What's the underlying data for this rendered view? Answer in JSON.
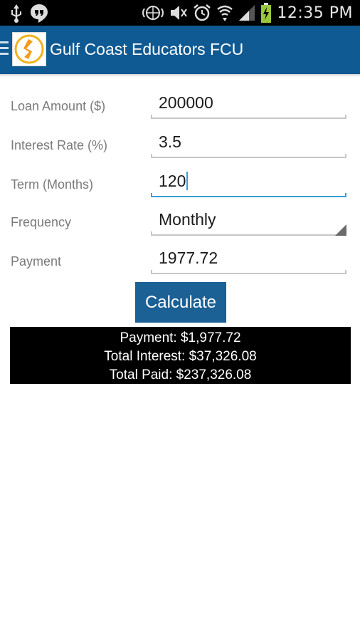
{
  "status_bar": {
    "time": "12:35 PM",
    "icons": [
      "usb-icon",
      "hangouts-icon",
      "nfc-icon",
      "mute-icon",
      "alarm-icon",
      "wifi-icon",
      "signal-icon",
      "battery-charging-icon"
    ]
  },
  "app_bar": {
    "title": "Gulf Coast Educators FCU",
    "color": "#0f5a93"
  },
  "form": {
    "loan_amount": {
      "label": "Loan Amount ($)",
      "value": "200000"
    },
    "interest_rate": {
      "label": "Interest Rate (%)",
      "value": "3.5"
    },
    "term": {
      "label": "Term (Months)",
      "value": "120"
    },
    "frequency": {
      "label": "Frequency",
      "value": "Monthly"
    },
    "payment": {
      "label": "Payment",
      "value": "1977.72"
    }
  },
  "calculate_button": {
    "label": "Calculate",
    "color": "#1b6196"
  },
  "results": {
    "payment": "Payment: $1,977.72",
    "total_interest": "Total Interest: $37,326.08",
    "total_paid": "Total Paid: $237,326.08"
  }
}
